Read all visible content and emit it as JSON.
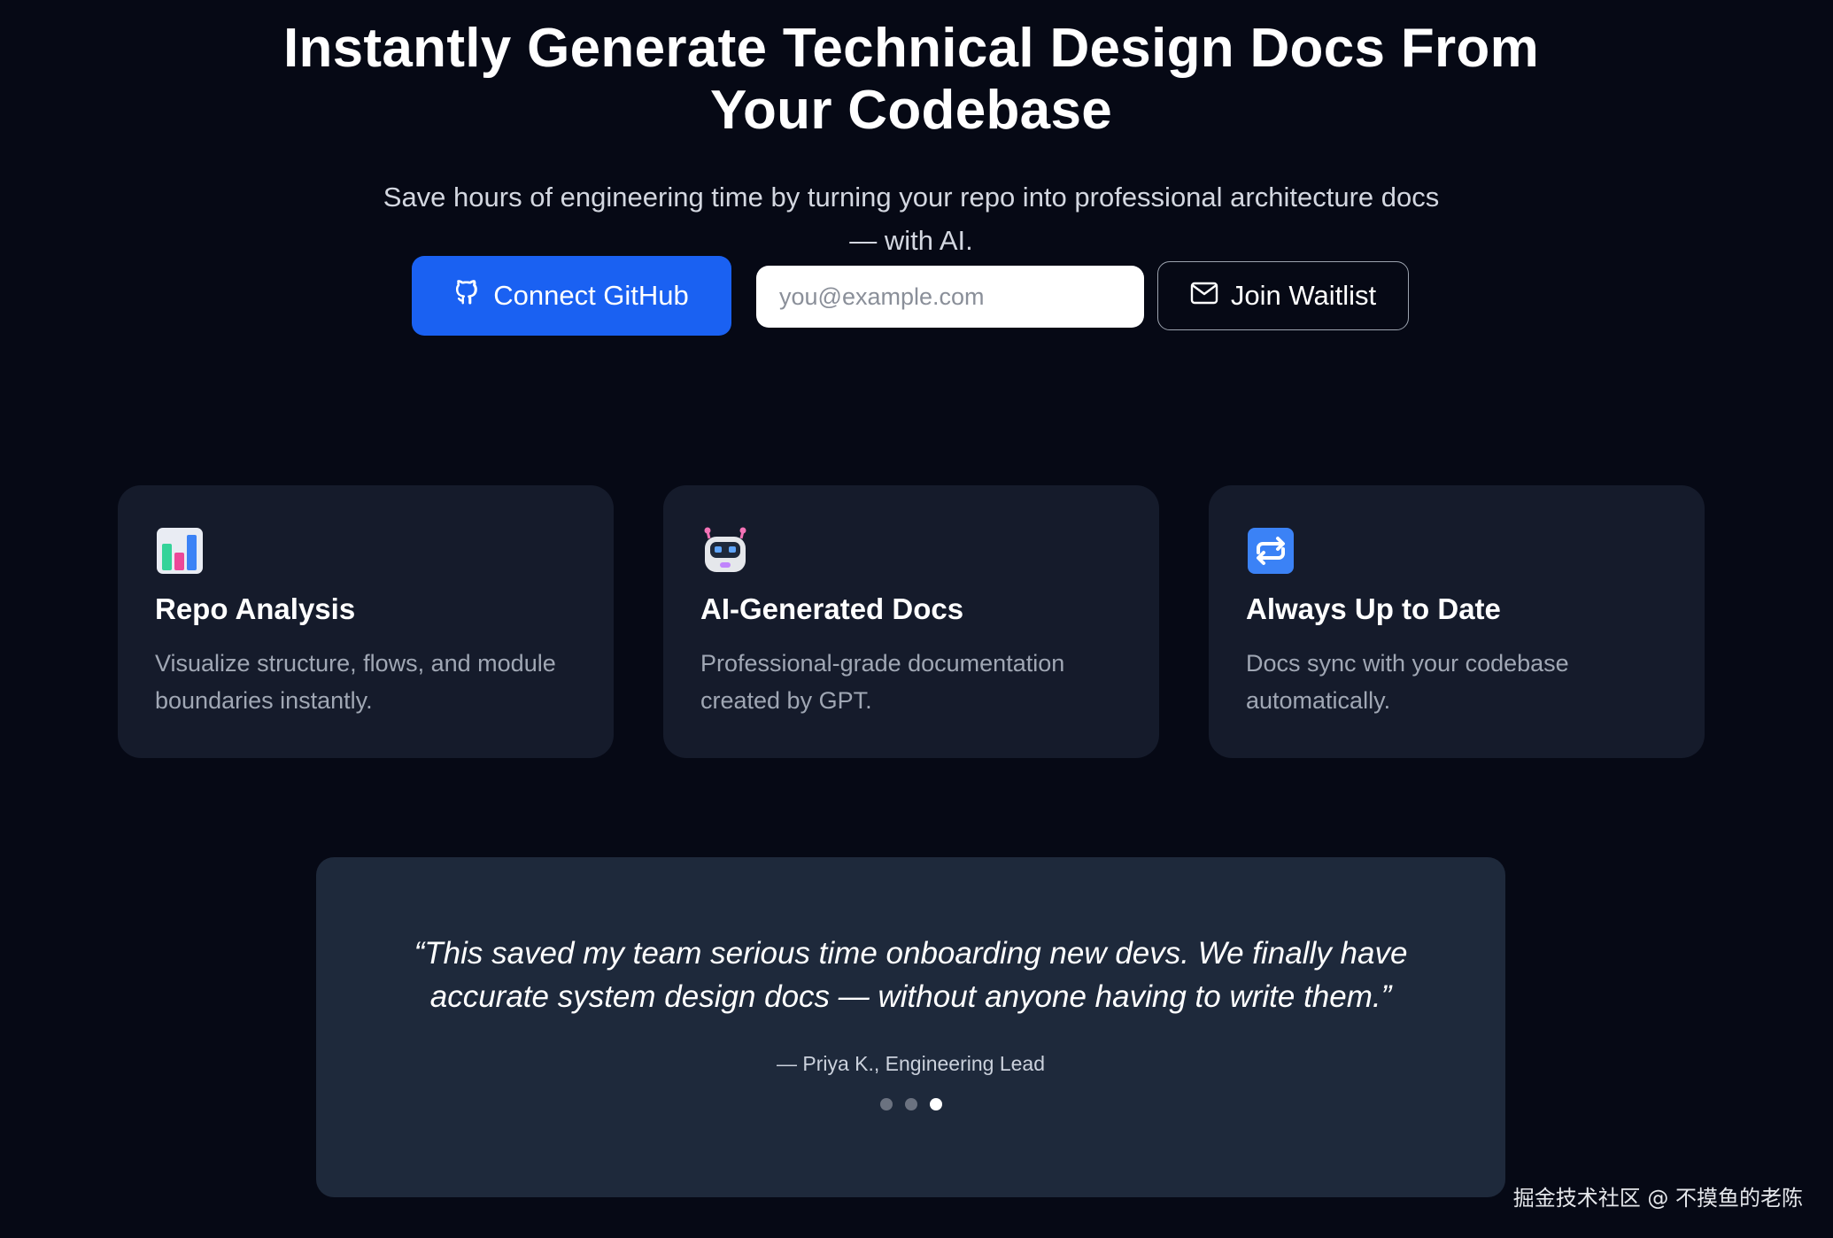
{
  "hero": {
    "title": "Instantly Generate Technical Design Docs From Your Codebase",
    "subtitle": "Save hours of engineering time by turning your repo into professional architecture docs — with AI."
  },
  "cta": {
    "github_label": "Connect GitHub",
    "email_placeholder": "you@example.com",
    "email_value": "",
    "waitlist_label": "Join Waitlist"
  },
  "features": [
    {
      "icon": "bar-chart-icon",
      "title": "Repo Analysis",
      "description": "Visualize structure, flows, and module boundaries instantly."
    },
    {
      "icon": "robot-icon",
      "title": "AI-Generated Docs",
      "description": "Professional-grade documentation created by GPT."
    },
    {
      "icon": "repeat-icon",
      "title": "Always Up to Date",
      "description": "Docs sync with your codebase automatically."
    }
  ],
  "testimonial": {
    "quote": "“This saved my team serious time onboarding new devs. We finally have accurate system design docs — without anyone having to write them.”",
    "author": "— Priya K., Engineering Lead",
    "dot_count": 3,
    "active_dot": 3
  },
  "watermark": "掘金技术社区 @ 不摸鱼的老陈",
  "colors": {
    "background": "#060915",
    "primary": "#1a61f2",
    "card": "#151b2b",
    "testimonial": "#1e293b"
  }
}
